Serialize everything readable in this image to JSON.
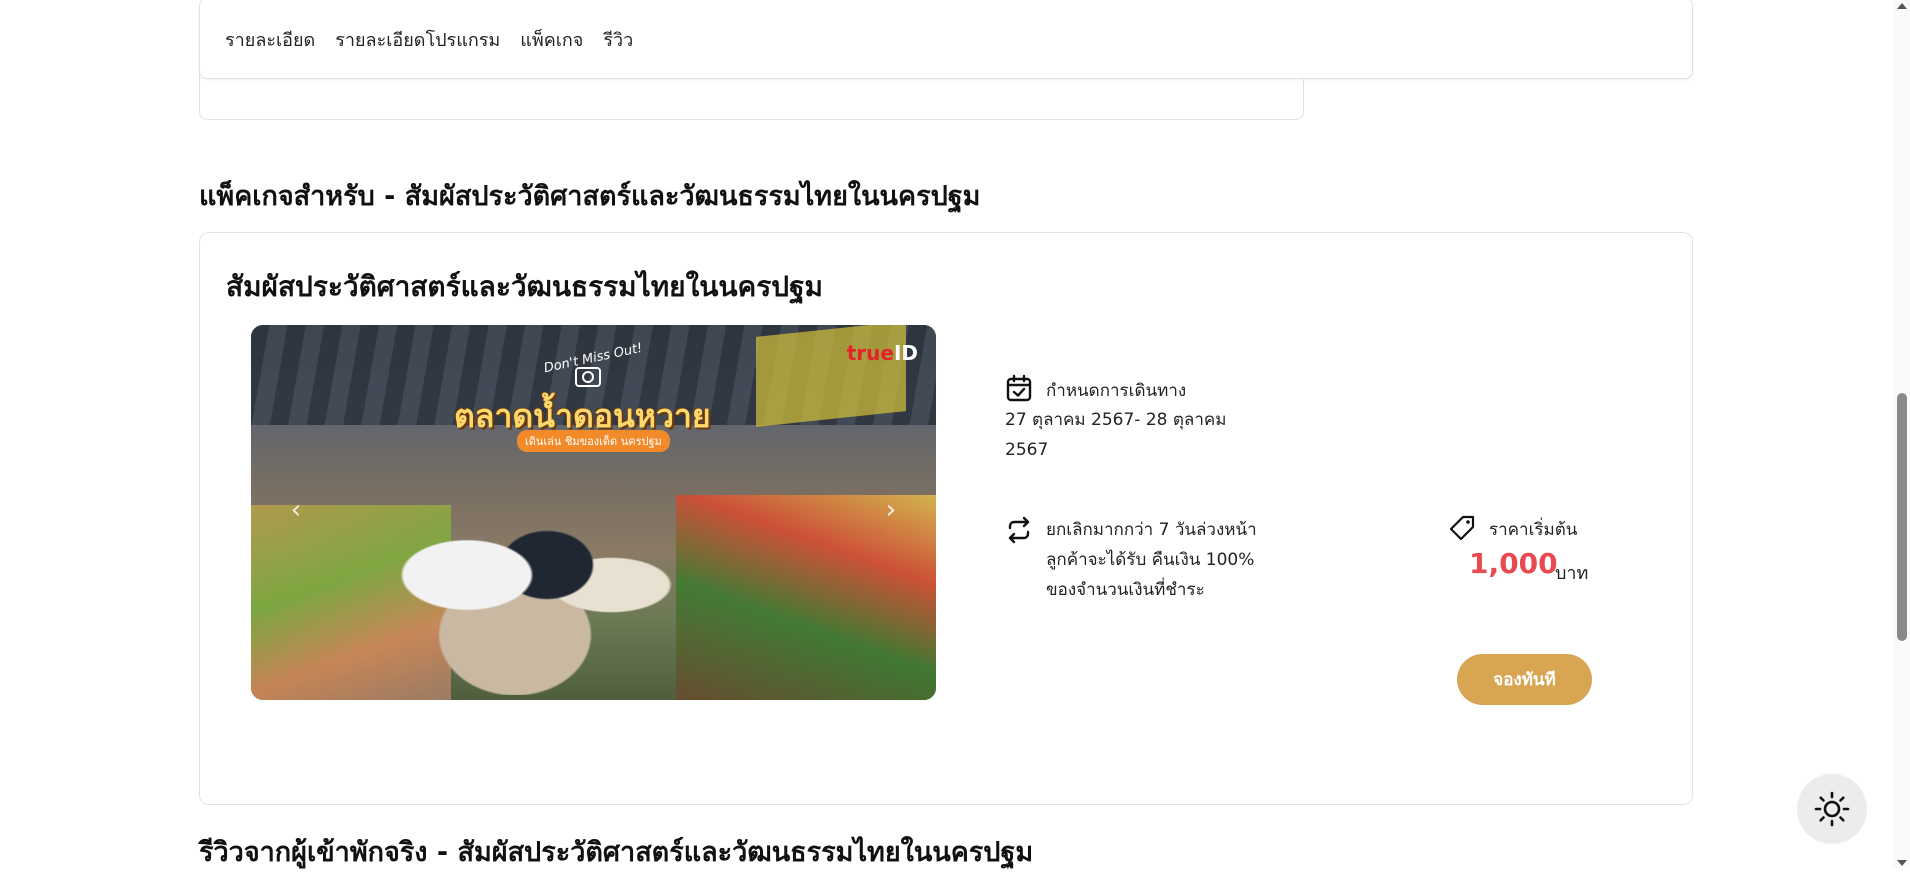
{
  "nav": {
    "tabs": [
      "รายละเอียด",
      "รายละเอียดโปรแกรม",
      "แพ็คเกจ",
      "รีวิว"
    ]
  },
  "packages_section": {
    "title": "แพ็คเกจสำหรับ - สัมผัสประวัติศาสตร์และวัฒนธรรมไทยในนครปฐม"
  },
  "package": {
    "title": "สัมผัสประวัติศาสตร์และวัฒนธรรมไทยในนครปฐม",
    "image": {
      "overlay_small": "Don't Miss Out!",
      "overlay_title": "ตลาดน้ำดอนหวาย",
      "overlay_subtitle": "เดินเล่น ชิมของเด็ด นครปฐม",
      "logo_red": "true",
      "logo_white": "ID"
    },
    "schedule": {
      "icon": "calendar-check-icon",
      "label": "กำหนดการเดินทาง",
      "value": "27 ตุลาคม 2567- 28 ตุลาคม 2567"
    },
    "cancellation": {
      "icon": "repeat-icon",
      "text": "ยกเลิกมากกว่า 7 วันล่วงหน้า ลูกค้าจะได้รับ คืนเงิน 100% ของจำนวนเงินที่ชำระ"
    },
    "price": {
      "icon": "price-tag-icon",
      "label": "ราคาเริ่มต้น",
      "value": "1,000",
      "unit": "บาท",
      "color": "#e84a4f"
    },
    "book_button": "จองทันที",
    "button_color": "#d8a653"
  },
  "reviews_section": {
    "title": "รีวิวจากผู้เข้าพักจริง - สัมผัสประวัติศาสตร์และวัฒนธรรมไทยในนครปฐม"
  },
  "floating": {
    "theme_toggle_icon": "sun-icon"
  }
}
